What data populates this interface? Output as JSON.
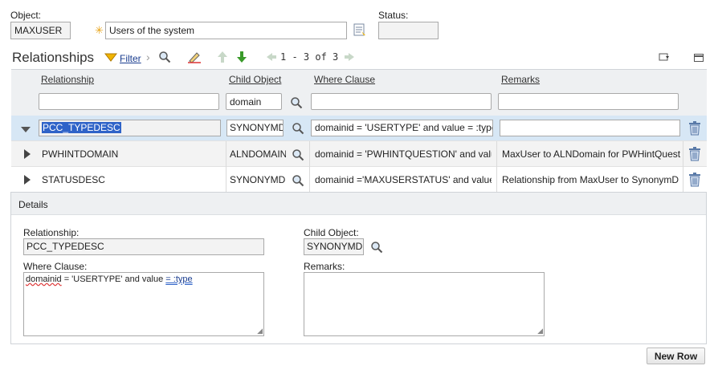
{
  "header": {
    "object_label": "Object:",
    "object_value": "MAXUSER",
    "description_value": "Users of the system",
    "status_label": "Status:",
    "status_value": ""
  },
  "toolbar": {
    "section_title": "Relationships",
    "filter_label": "Filter",
    "pagination": "1 - 3 of 3"
  },
  "table": {
    "columns": [
      "Relationship",
      "Child Object",
      "Where Clause",
      "Remarks"
    ],
    "filters": {
      "relationship": "",
      "child_object": "domain",
      "where_clause": "",
      "remarks": ""
    },
    "rows": [
      {
        "relationship": "PCC_TYPEDESC",
        "child_object": "SYNONYMD",
        "where_clause": "domainid = 'USERTYPE' and value = :type",
        "remarks": "",
        "expanded": true
      },
      {
        "relationship": "PWHINTDOMAIN",
        "child_object": "ALNDOMAIN",
        "where_clause": "domainid = 'PWHINTQUESTION' and value =",
        "remarks": "MaxUser to ALNDomain for PWHintQuestion",
        "expanded": false
      },
      {
        "relationship": "STATUSDESC",
        "child_object": "SYNONYMD",
        "where_clause": "domainid ='MAXUSERSTATUS' and value =",
        "remarks": "Relationship from MaxUser to SynonymDoma",
        "expanded": false
      }
    ]
  },
  "details": {
    "title": "Details",
    "relationship_label": "Relationship:",
    "relationship_value": "PCC_TYPEDESC",
    "child_object_label": "Child Object:",
    "child_object_value": "SYNONYMDC",
    "where_label": "Where Clause:",
    "where_value_part1": "domainid",
    "where_value_part2": " = 'USERTYPE' and value ",
    "where_value_part3": "= :type",
    "remarks_label": "Remarks:",
    "remarks_value": ""
  },
  "footer": {
    "new_row_label": "New Row"
  },
  "colors": {
    "selected_row": "#d7e7f5",
    "header_bg": "#eef0f2",
    "highlight": "#2f63c8",
    "accent_green": "#3a9a2a",
    "required_star": "#e8a317"
  }
}
